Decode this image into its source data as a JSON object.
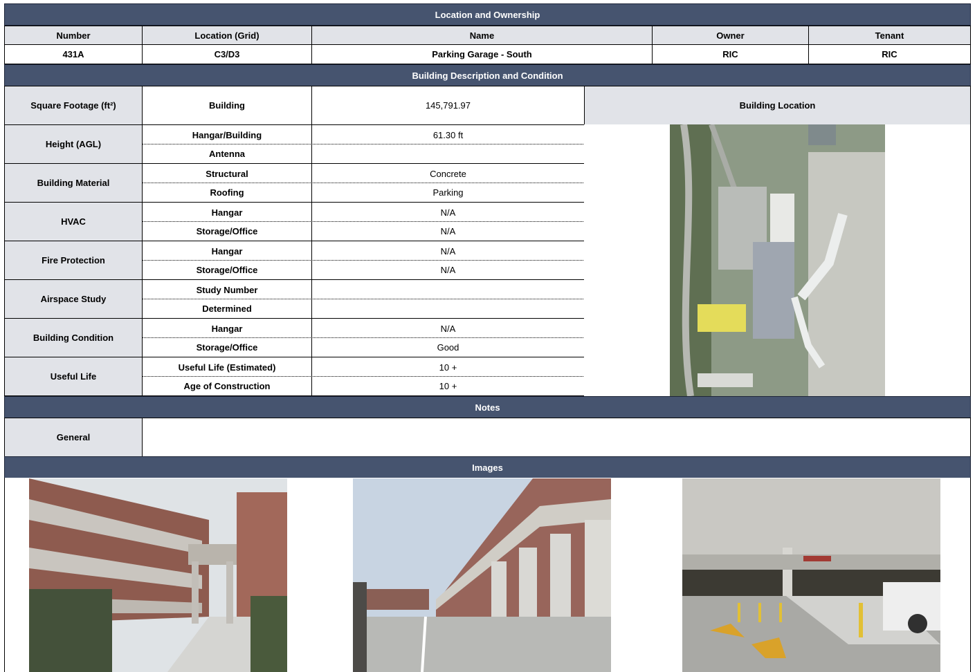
{
  "location_section": {
    "title": "Location and Ownership",
    "headers": [
      "Number",
      "Location (Grid)",
      "Name",
      "Owner",
      "Tenant"
    ],
    "values": [
      "431A",
      "C3/D3",
      "Parking Garage - South",
      "RIC",
      "RIC"
    ]
  },
  "description_section": {
    "title": "Building Description and Condition",
    "square_footage": {
      "label": "Square Footage (ft²)",
      "sub": "Building",
      "value": "145,791.97"
    },
    "building_location_label": "Building Location",
    "groups": [
      {
        "label": "Height (AGL)",
        "rows": [
          {
            "sub": "Hangar/Building",
            "value": "61.30 ft"
          },
          {
            "sub": "Antenna",
            "value": ""
          }
        ]
      },
      {
        "label": "Building Material",
        "rows": [
          {
            "sub": "Structural",
            "value": "Concrete"
          },
          {
            "sub": "Roofing",
            "value": "Parking"
          }
        ]
      },
      {
        "label": "HVAC",
        "rows": [
          {
            "sub": "Hangar",
            "value": "N/A"
          },
          {
            "sub": "Storage/Office",
            "value": "N/A"
          }
        ]
      },
      {
        "label": "Fire Protection",
        "rows": [
          {
            "sub": "Hangar",
            "value": "N/A"
          },
          {
            "sub": "Storage/Office",
            "value": "N/A"
          }
        ]
      },
      {
        "label": "Airspace Study",
        "rows": [
          {
            "sub": "Study Number",
            "value": ""
          },
          {
            "sub": "Determined",
            "value": ""
          }
        ]
      },
      {
        "label": "Building Condition",
        "rows": [
          {
            "sub": "Hangar",
            "value": "N/A"
          },
          {
            "sub": "Storage/Office",
            "value": "Good"
          }
        ]
      },
      {
        "label": "Useful Life",
        "rows": [
          {
            "sub": "Useful Life (Estimated)",
            "value": "10 +"
          },
          {
            "sub": "Age of Construction",
            "value": "10 +"
          }
        ]
      }
    ]
  },
  "notes_section": {
    "title": "Notes",
    "general_label": "General",
    "general_value": ""
  },
  "images_section": {
    "title": "Images"
  },
  "colors": {
    "header_bg": "#46546f",
    "label_bg": "#e1e3e8",
    "highlight": "#e4dc5a"
  }
}
